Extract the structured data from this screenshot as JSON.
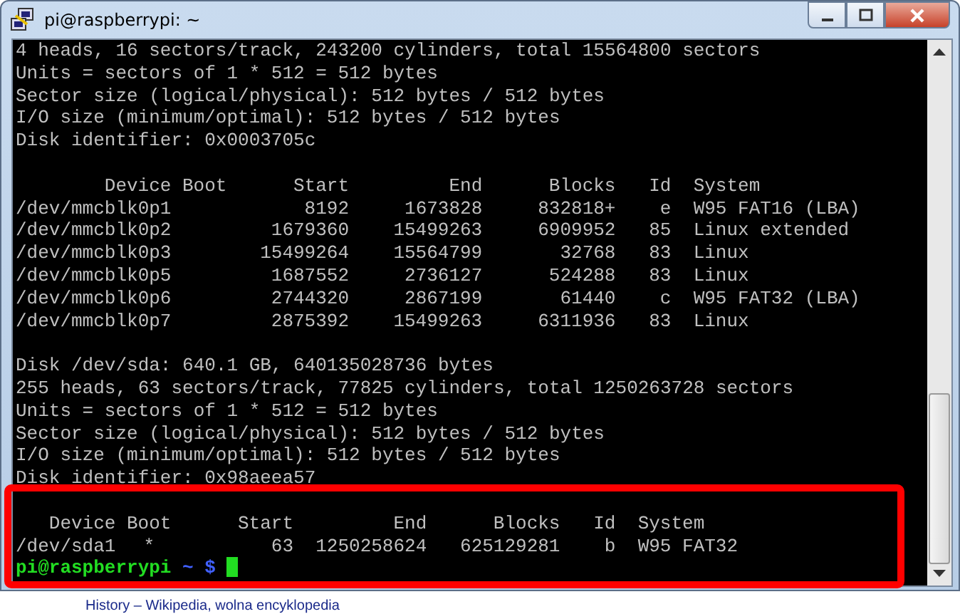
{
  "window": {
    "title": "pi@raspberrypi: ~"
  },
  "terminal": {
    "blocks": [
      {
        "kind": "text",
        "lines": [
          "4 heads, 16 sectors/track, 243200 cylinders, total 15564800 sectors",
          "Units = sectors of 1 * 512 = 512 bytes",
          "Sector size (logical/physical): 512 bytes / 512 bytes",
          "I/O size (minimum/optimal): 512 bytes / 512 bytes",
          "Disk identifier: 0x0003705c"
        ]
      },
      {
        "kind": "blank"
      },
      {
        "kind": "table",
        "header": {
          "device": "Device",
          "boot": "Boot",
          "start": "Start",
          "end": "End",
          "blocks": "Blocks",
          "id": "Id",
          "system": "System"
        },
        "rows": [
          {
            "device": "/dev/mmcblk0p1",
            "boot": "",
            "start": "8192",
            "end": "1673828",
            "blocks": "832818+",
            "id": "e",
            "system": "W95 FAT16 (LBA)"
          },
          {
            "device": "/dev/mmcblk0p2",
            "boot": "",
            "start": "1679360",
            "end": "15499263",
            "blocks": "6909952",
            "id": "85",
            "system": "Linux extended"
          },
          {
            "device": "/dev/mmcblk0p3",
            "boot": "",
            "start": "15499264",
            "end": "15564799",
            "blocks": "32768",
            "id": "83",
            "system": "Linux"
          },
          {
            "device": "/dev/mmcblk0p5",
            "boot": "",
            "start": "1687552",
            "end": "2736127",
            "blocks": "524288",
            "id": "83",
            "system": "Linux"
          },
          {
            "device": "/dev/mmcblk0p6",
            "boot": "",
            "start": "2744320",
            "end": "2867199",
            "blocks": "61440",
            "id": "c",
            "system": "W95 FAT32 (LBA)"
          },
          {
            "device": "/dev/mmcblk0p7",
            "boot": "",
            "start": "2875392",
            "end": "15499263",
            "blocks": "6311936",
            "id": "83",
            "system": "Linux"
          }
        ]
      },
      {
        "kind": "blank"
      },
      {
        "kind": "text",
        "lines": [
          "Disk /dev/sda: 640.1 GB, 640135028736 bytes",
          "255 heads, 63 sectors/track, 77825 cylinders, total 1250263728 sectors",
          "Units = sectors of 1 * 512 = 512 bytes",
          "Sector size (logical/physical): 512 bytes / 512 bytes",
          "I/O size (minimum/optimal): 512 bytes / 512 bytes",
          "Disk identifier: 0x98aeea57"
        ]
      },
      {
        "kind": "blank"
      },
      {
        "kind": "table",
        "header": {
          "device": "Device",
          "boot": "Boot",
          "start": "Start",
          "end": "End",
          "blocks": "Blocks",
          "id": "Id",
          "system": "System"
        },
        "rows": [
          {
            "device": "/dev/sda1",
            "boot": "*",
            "start": "63",
            "end": "1250258624",
            "blocks": "625129281",
            "id": "b",
            "system": "W95 FAT32"
          }
        ]
      }
    ],
    "prompt": {
      "user_host": "pi@raspberrypi",
      "path": "~ $"
    }
  },
  "background_text": "History – Wikipedia, wolna encyklopedia"
}
